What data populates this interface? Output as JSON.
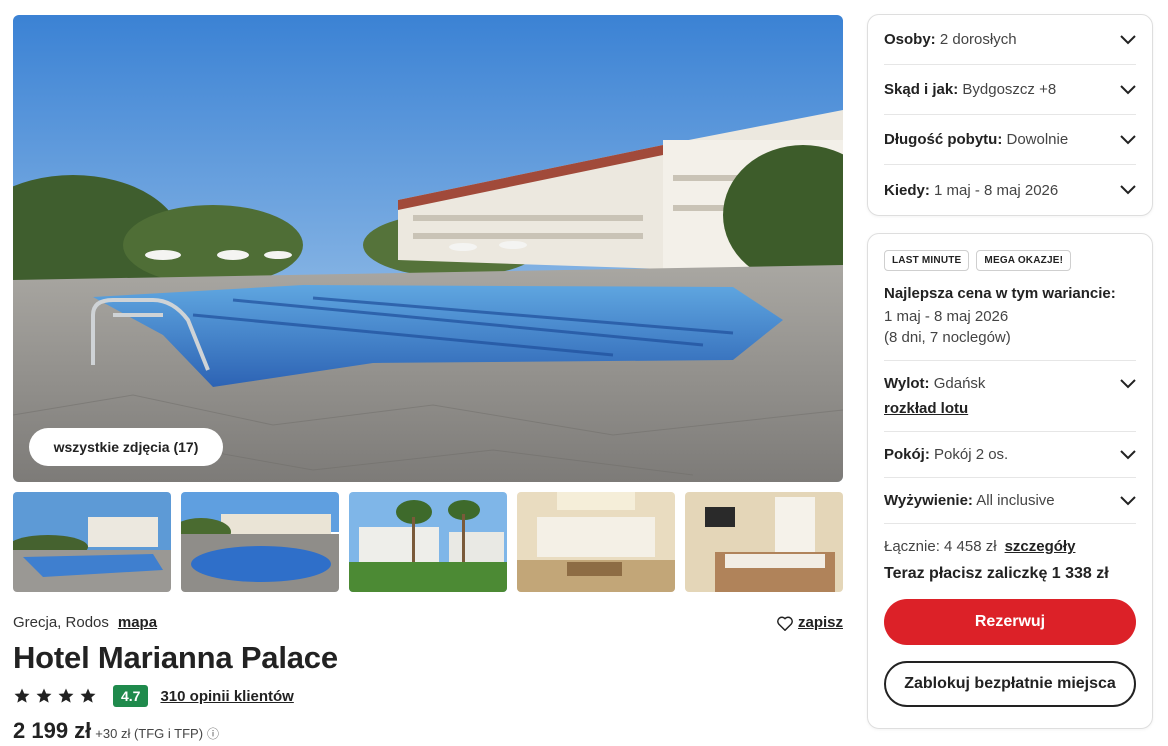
{
  "gallery": {
    "all_photos_label": "wszystkie zdjęcia (17)",
    "thumbnails": [
      "pool-view",
      "pool-garden",
      "palms-garden",
      "lobby",
      "hotel-room"
    ]
  },
  "hotel": {
    "location": "Grecja, Rodos",
    "map_label": "mapa",
    "save_label": "zapisz",
    "name": "Hotel Marianna Palace",
    "stars": 4,
    "score": "4.7",
    "reviews_label": "310 opinii klientów",
    "price": "2 199 zł",
    "price_extra": "+30 zł (TFG i TFP)",
    "info_icon": "ⓘ"
  },
  "filters": {
    "people": {
      "label": "Osoby:",
      "value": "2 dorosłych"
    },
    "from": {
      "label": "Skąd i jak:",
      "value": "Bydgoszcz +8"
    },
    "length": {
      "label": "Długość pobytu:",
      "value": "Dowolnie"
    },
    "when": {
      "label": "Kiedy:",
      "value": "1 maj - 8 maj 2026"
    }
  },
  "offer": {
    "badges": [
      "LAST MINUTE",
      "MEGA OKAZJE!"
    ],
    "best_title": "Najlepsza cena w tym wariancie:",
    "best_dates": "1 maj - 8 maj 2026",
    "best_nights": "(8 dni, 7 noclegów)",
    "flight": {
      "label": "Wylot:",
      "value": "Gdańsk",
      "link": "rozkład lotu"
    },
    "room": {
      "label": "Pokój:",
      "value": "Pokój 2 os."
    },
    "board": {
      "label": "Wyżywienie:",
      "value": "All inclusive"
    },
    "total_label": "Łącznie: 4 458 zł",
    "details_link": "szczegóły",
    "deposit": "Teraz płacisz zaliczkę 1 338 zł",
    "book_button": "Rezerwuj",
    "block_button": "Zablokuj bezpłatnie miejsca"
  },
  "colors": {
    "accent_red": "#dc2128",
    "score_green": "#1f8a4c"
  },
  "icons": {
    "chevron": "chevron-down-icon",
    "heart": "heart-icon",
    "star": "star-icon"
  }
}
